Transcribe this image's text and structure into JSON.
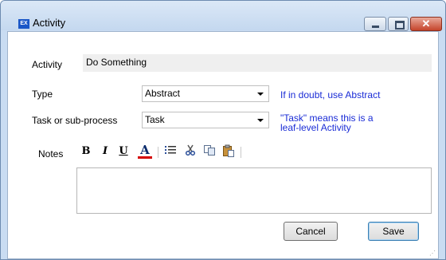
{
  "window": {
    "title": "Activity",
    "icon_text": "EX",
    "controls": {
      "minimize": "minimize",
      "maximize": "maximize",
      "close": "✕"
    }
  },
  "form": {
    "activity": {
      "label": "Activity",
      "value": "Do Something"
    },
    "type": {
      "label": "Type",
      "value": "Abstract",
      "hint": "If in doubt, use Abstract"
    },
    "task": {
      "label": "Task or sub-process",
      "value": "Task",
      "hint_line1": "\"Task\" means this is a",
      "hint_line2": "leaf-level  Activity"
    },
    "notes": {
      "label": "Notes",
      "toolbar": {
        "bold": "B",
        "italic": "I",
        "underline": "U",
        "font_color": "A",
        "list_icon": "bullet-list-icon",
        "cut_icon": "scissors-icon",
        "copy_icon": "copy-icon",
        "paste_icon": "paste-icon"
      },
      "value": ""
    }
  },
  "buttons": {
    "cancel": "Cancel",
    "save": "Save"
  },
  "colors": {
    "hint": "#1a2cd6",
    "titlebar": "#c9dcf2",
    "font_color_underline": "#d40000"
  }
}
